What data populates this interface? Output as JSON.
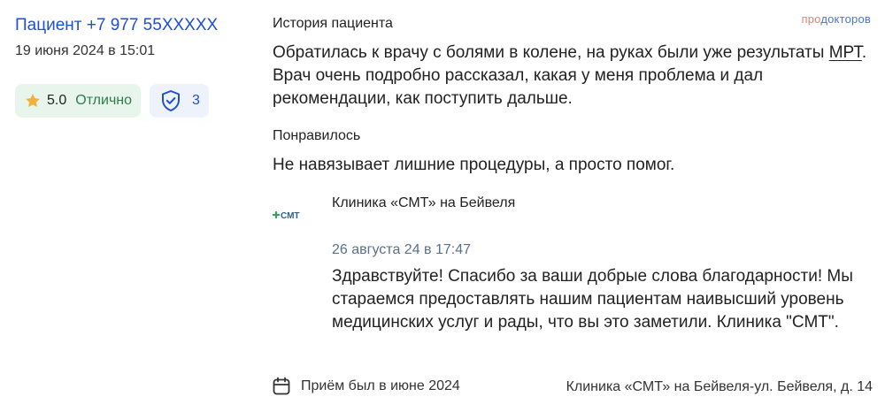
{
  "review": {
    "author": "Пациент +7 977 55XXXXX",
    "date": "19 июня 2024 в 15:01",
    "rating_value": "5.0",
    "rating_label": "Отлично",
    "verify_count": "3"
  },
  "brand": {
    "part1": "про",
    "part2": "докторов"
  },
  "history": {
    "title": "История пациента",
    "text_before": "Обратилась к врачу с болями в колене, на руках были уже результаты ",
    "text_link": "МРТ",
    "text_after": ". Врач очень подробно рассказал, какая у меня проблема и дал рекомендации, как поступить дальше."
  },
  "liked": {
    "title": "Понравилось",
    "text": "Не навязывает лишние процедуры, а просто помог."
  },
  "reply": {
    "clinic_logo_text": "СМТ",
    "clinic_name": "Клиника «СМТ» на Бейвеля",
    "date": "26 августа 24 в 17:47",
    "text": "Здравствуйте! Спасибо за ваши добрые слова благодарности! Мы стараемся предоставлять нашим пациентам наивысший уровень медицинских услуг и рады, что вы это заметили. Клиника \"СМТ\"."
  },
  "footer": {
    "visit": "Приём был в июне 2024",
    "address": "Клиника «СМТ» на Бейвеля-ул. Бейвеля, д. 14"
  },
  "colors": {
    "link_blue": "#1f4fd1",
    "rating_bg": "#e8f5ec",
    "rating_green": "#2f7d4a",
    "star": "#f2b13c",
    "verify_bg": "#eef2fb",
    "clinic_green": "#3a9a6a"
  },
  "icons": {
    "rating": "star-icon",
    "verify": "shield-check-icon",
    "visit": "calendar-icon"
  }
}
